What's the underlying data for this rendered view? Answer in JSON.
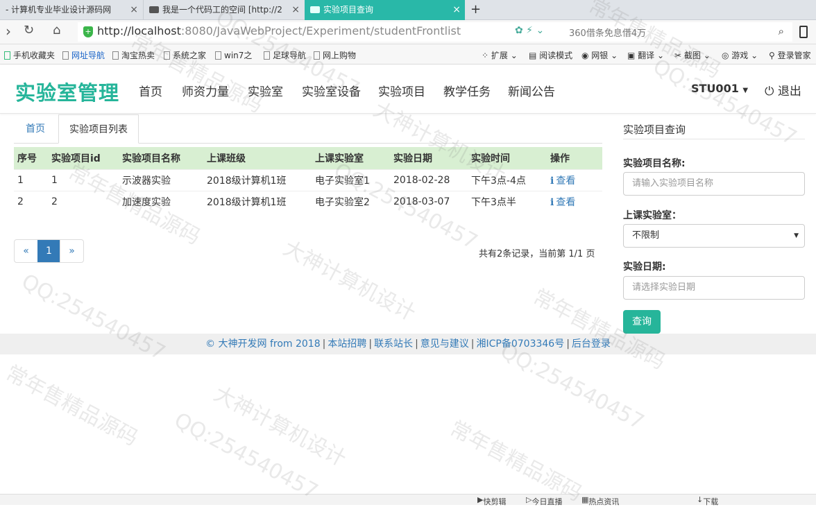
{
  "browser": {
    "tabs": [
      {
        "title": "- 计算机专业毕业设计源码网"
      },
      {
        "title": "我是一个代码工的空间 [http://2"
      },
      {
        "title": "实验项目查询"
      }
    ],
    "url_host": "http://localhost",
    "url_path": ":8080/JavaWebProject/Experiment/studentFrontlist",
    "url_suggest": "360借条免息借4万",
    "bookmarks": [
      "手机收藏夹",
      "网址导航",
      "淘宝热卖",
      "系统之家",
      "win7之",
      "足球导航",
      "网上购物"
    ],
    "toolbar_right": [
      "扩展",
      "阅读模式",
      "网银",
      "翻译",
      "截图",
      "游戏",
      "登录管家"
    ]
  },
  "site": {
    "logo": "实验室管理",
    "nav": [
      "首页",
      "师资力量",
      "实验室",
      "实验室设备",
      "实验项目",
      "教学任务",
      "新闻公告"
    ],
    "user": "STU001",
    "logout": "退出"
  },
  "main": {
    "breadcrumb_home": "首页",
    "active_tab": "实验项目列表",
    "columns": [
      "序号",
      "实验项目id",
      "实验项目名称",
      "上课班级",
      "上课实验室",
      "实验日期",
      "实验时间",
      "操作"
    ],
    "rows": [
      {
        "no": "1",
        "id": "1",
        "name": "示波器实验",
        "class": "2018级计算机1班",
        "room": "电子实验室1",
        "date": "2018-02-28",
        "time": "下午3点-4点",
        "action": "查看"
      },
      {
        "no": "2",
        "id": "2",
        "name": "加速度实验",
        "class": "2018级计算机1班",
        "room": "电子实验室2",
        "date": "2018-03-07",
        "time": "下午3点半",
        "action": "查看"
      }
    ],
    "pager": {
      "prev": "«",
      "current": "1",
      "next": "»"
    },
    "page_info": "共有2条记录，当前第 1/1 页"
  },
  "sidebar": {
    "title": "实验项目查询",
    "name_label": "实验项目名称:",
    "name_placeholder": "请输入实验项目名称",
    "room_label": "上课实验室：",
    "room_value": "不限制",
    "date_label": "实验日期:",
    "date_placeholder": "请选择实验日期",
    "submit": "查询"
  },
  "footer": {
    "copyright": "© 大神开发网 from 2018",
    "links": [
      "本站招聘",
      "联系站长",
      "意见与建议",
      "湘ICP备0703346号",
      "后台登录"
    ]
  },
  "statusbar": [
    "快剪辑",
    "今日直播",
    "热点资讯",
    "下载"
  ],
  "watermark": [
    "常年售精品源码",
    "QQ:254540457",
    "大神计算机设计"
  ]
}
